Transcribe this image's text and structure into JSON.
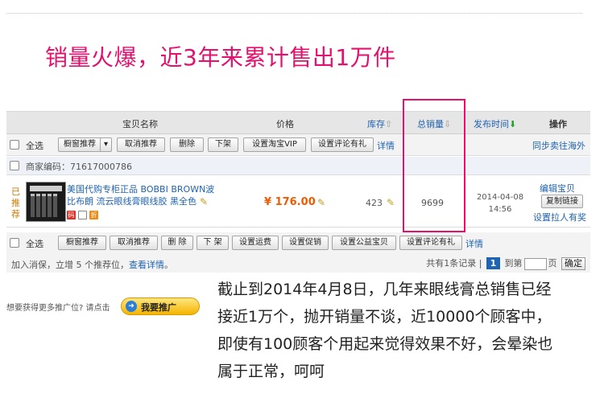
{
  "headline": "销量火爆，近3年来累计售出1万件",
  "table": {
    "columns": {
      "name": "宝贝名称",
      "price": "价格",
      "stock": "库存",
      "sales": "总销量",
      "date": "发布时间",
      "ops": "操作"
    },
    "top_bar": {
      "select_all": "全选",
      "buttons": [
        "橱窗推荐",
        "取消推荐",
        "删除",
        "下架",
        "设置淘宝VIP",
        "设置评论有礼"
      ],
      "detail": "详情",
      "right_link": "同步卖往海外"
    },
    "merchant_code": "商家编码：71617000786",
    "row": {
      "recommend": "已推荐",
      "title": "美国代购专柜正品 BOBBI BROWN波比布朗 流云眼线膏眼线胶 黑全色",
      "price": "¥ 176.00",
      "stock": "423",
      "sales": "9699",
      "date": "2014-04-08",
      "time": "14:56",
      "ops": {
        "edit": "编辑宝贝",
        "copy": "复制链接",
        "invite": "设置拉人有奖"
      },
      "tags": [
        "码",
        "折"
      ]
    },
    "bottom_bar": {
      "select_all": "全选",
      "buttons": [
        "橱窗推荐",
        "取消推荐",
        "删 除",
        "下 架",
        "设置运费",
        "设置促销",
        "设置公益宝贝",
        "设置评论有礼"
      ],
      "detail": "详情"
    },
    "footer": {
      "text": "加入消保，立增 5 个推荐位，",
      "link": "查看详情",
      "suffix": "。",
      "total": "共有1条记录",
      "current_page": "1",
      "goto_prefix": "到第",
      "goto_suffix": "页",
      "confirm": "确定"
    }
  },
  "promo": {
    "question": "想要获得更多推广位? 请点击",
    "button": "我要推广"
  },
  "paragraph": "截止到2014年4月8日，几年来眼线膏总销售已经接近1万个，抛开销量不谈，近10000个顾客中，即使有100顾客个用起来觉得效果不好，会晕染也属于正常，呵呵",
  "colors": {
    "headline": "#e4106e",
    "highlight": "#e4106e",
    "link": "#1f63b3",
    "price": "#f05b00"
  }
}
